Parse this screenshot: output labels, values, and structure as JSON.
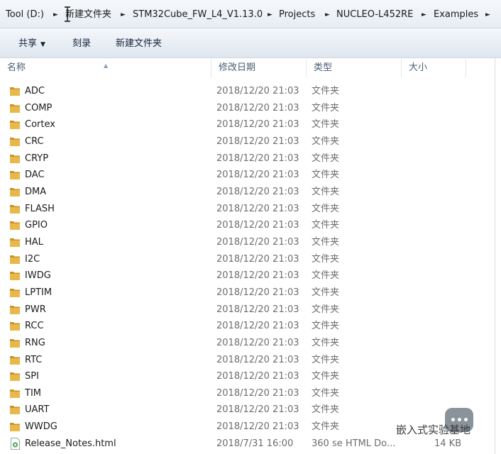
{
  "breadcrumb": {
    "items": [
      "Tool (D:)",
      "新建文件夹",
      "STM32Cube_FW_L4_V1.13.0",
      "Projects",
      "NUCLEO-L452RE",
      "Examples"
    ],
    "separator": "►"
  },
  "toolbar": {
    "share_label": "共享",
    "burn_label": "刻录",
    "new_folder_label": "新建文件夹"
  },
  "columns": {
    "name": "名称",
    "date": "修改日期",
    "type": "类型",
    "size": "大小"
  },
  "rows": [
    {
      "name": "ADC",
      "date": "2018/12/20 21:03",
      "type": "文件夹",
      "size": ""
    },
    {
      "name": "COMP",
      "date": "2018/12/20 21:03",
      "type": "文件夹",
      "size": ""
    },
    {
      "name": "Cortex",
      "date": "2018/12/20 21:03",
      "type": "文件夹",
      "size": ""
    },
    {
      "name": "CRC",
      "date": "2018/12/20 21:03",
      "type": "文件夹",
      "size": ""
    },
    {
      "name": "CRYP",
      "date": "2018/12/20 21:03",
      "type": "文件夹",
      "size": ""
    },
    {
      "name": "DAC",
      "date": "2018/12/20 21:03",
      "type": "文件夹",
      "size": ""
    },
    {
      "name": "DMA",
      "date": "2018/12/20 21:03",
      "type": "文件夹",
      "size": ""
    },
    {
      "name": "FLASH",
      "date": "2018/12/20 21:03",
      "type": "文件夹",
      "size": ""
    },
    {
      "name": "GPIO",
      "date": "2018/12/20 21:03",
      "type": "文件夹",
      "size": ""
    },
    {
      "name": "HAL",
      "date": "2018/12/20 21:03",
      "type": "文件夹",
      "size": ""
    },
    {
      "name": "I2C",
      "date": "2018/12/20 21:03",
      "type": "文件夹",
      "size": ""
    },
    {
      "name": "IWDG",
      "date": "2018/12/20 21:03",
      "type": "文件夹",
      "size": ""
    },
    {
      "name": "LPTIM",
      "date": "2018/12/20 21:03",
      "type": "文件夹",
      "size": ""
    },
    {
      "name": "PWR",
      "date": "2018/12/20 21:03",
      "type": "文件夹",
      "size": ""
    },
    {
      "name": "RCC",
      "date": "2018/12/20 21:03",
      "type": "文件夹",
      "size": ""
    },
    {
      "name": "RNG",
      "date": "2018/12/20 21:03",
      "type": "文件夹",
      "size": ""
    },
    {
      "name": "RTC",
      "date": "2018/12/20 21:03",
      "type": "文件夹",
      "size": ""
    },
    {
      "name": "SPI",
      "date": "2018/12/20 21:03",
      "type": "文件夹",
      "size": ""
    },
    {
      "name": "TIM",
      "date": "2018/12/20 21:03",
      "type": "文件夹",
      "size": ""
    },
    {
      "name": "UART",
      "date": "2018/12/20 21:03",
      "type": "文件夹",
      "size": ""
    },
    {
      "name": "WWDG",
      "date": "2018/12/20 21:03",
      "type": "文件夹",
      "size": ""
    },
    {
      "name": "Release_Notes.html",
      "date": "2018/7/31 16:00",
      "type": "360 se HTML Do...",
      "size": "14 KB",
      "kind": "file"
    }
  ],
  "watermark": {
    "text": "嵌入式实验基地"
  },
  "colors": {
    "folder": "#e8b84a",
    "folder_dark": "#c8922a",
    "toolbar_text": "#14233c",
    "header_text": "#4a5c75",
    "meta_text": "#6d6d6d"
  }
}
